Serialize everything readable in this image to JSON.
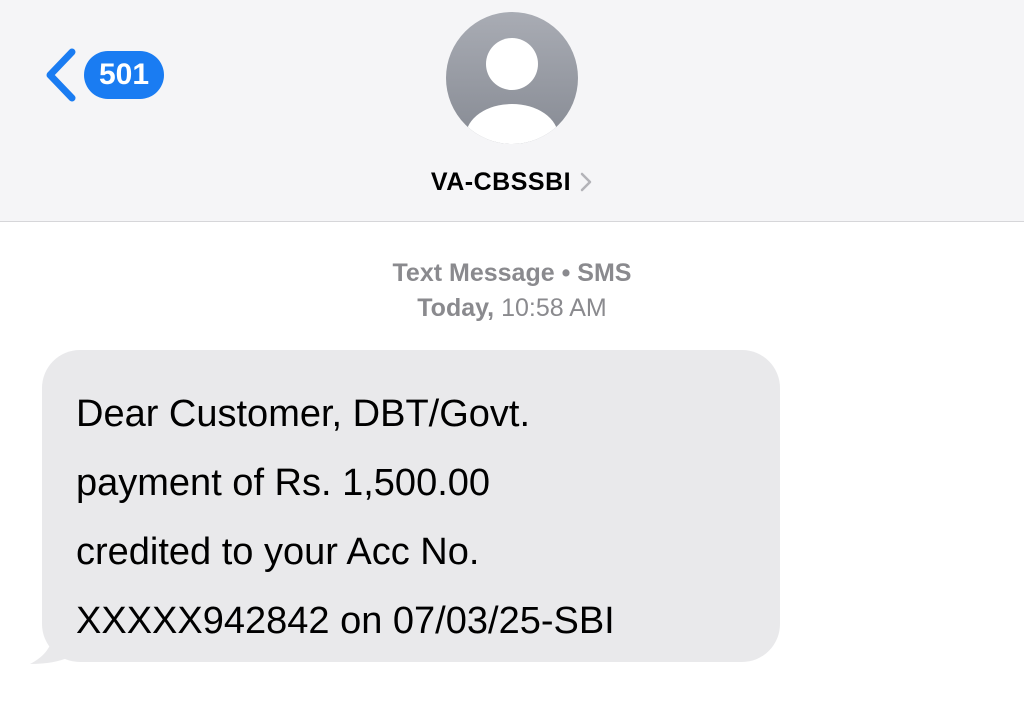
{
  "header": {
    "back_badge_count": "501",
    "contact_name": "VA-CBSSBI"
  },
  "conversation": {
    "message_type": "Text Message",
    "separator": "•",
    "service": "SMS",
    "day": "Today,",
    "time": "10:58 AM",
    "messages": [
      {
        "direction": "incoming",
        "lines": [
          "Dear Customer, DBT/Govt.",
          "payment of Rs. 1,500.00",
          "credited to your Acc No.",
          "XXXXX942842 on 07/03/25-SBI"
        ]
      }
    ]
  },
  "icons": {
    "back": "chevron-left-icon",
    "avatar": "person-silhouette-icon",
    "contact_detail": "chevron-right-icon"
  },
  "colors": {
    "accent": "#1a7cf2",
    "header_bg": "#f5f5f7",
    "bubble_incoming": "#e9e9eb",
    "meta_text": "#8a8a8e"
  }
}
